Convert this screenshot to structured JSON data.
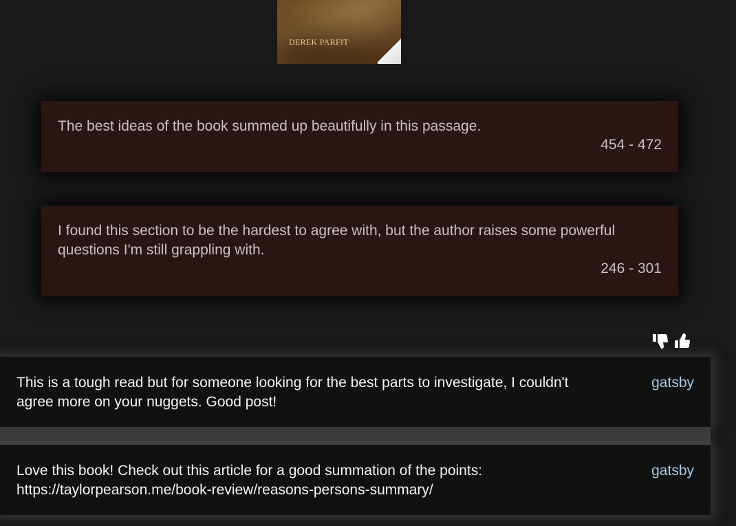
{
  "book": {
    "author": "DEREK PARFIT"
  },
  "highlights": [
    {
      "note": "The best ideas of the book summed up beautifully in this passage.",
      "range": "454 - 472"
    },
    {
      "note": "I found this section to be the hardest to agree with, but the author raises some powerful questions I'm still grappling with.",
      "range": "246 - 301"
    }
  ],
  "votes": {
    "icons": [
      "thumbs-down-icon",
      "thumbs-up-icon"
    ]
  },
  "comments": [
    {
      "text": "This is a tough read but for someone looking for the best parts to investigate, I couldn't agree more on your nuggets. Good post!",
      "author": "gatsby"
    },
    {
      "text": "Love this book! Check out this article for a good summation of the points: https://taylorpearson.me/book-review/reasons-persons-summary/",
      "author": "gatsby"
    }
  ],
  "colors": {
    "background": "#191919",
    "note_card": "#2a1515",
    "comment_card": "#111111",
    "author_link": "#a3cde3"
  }
}
